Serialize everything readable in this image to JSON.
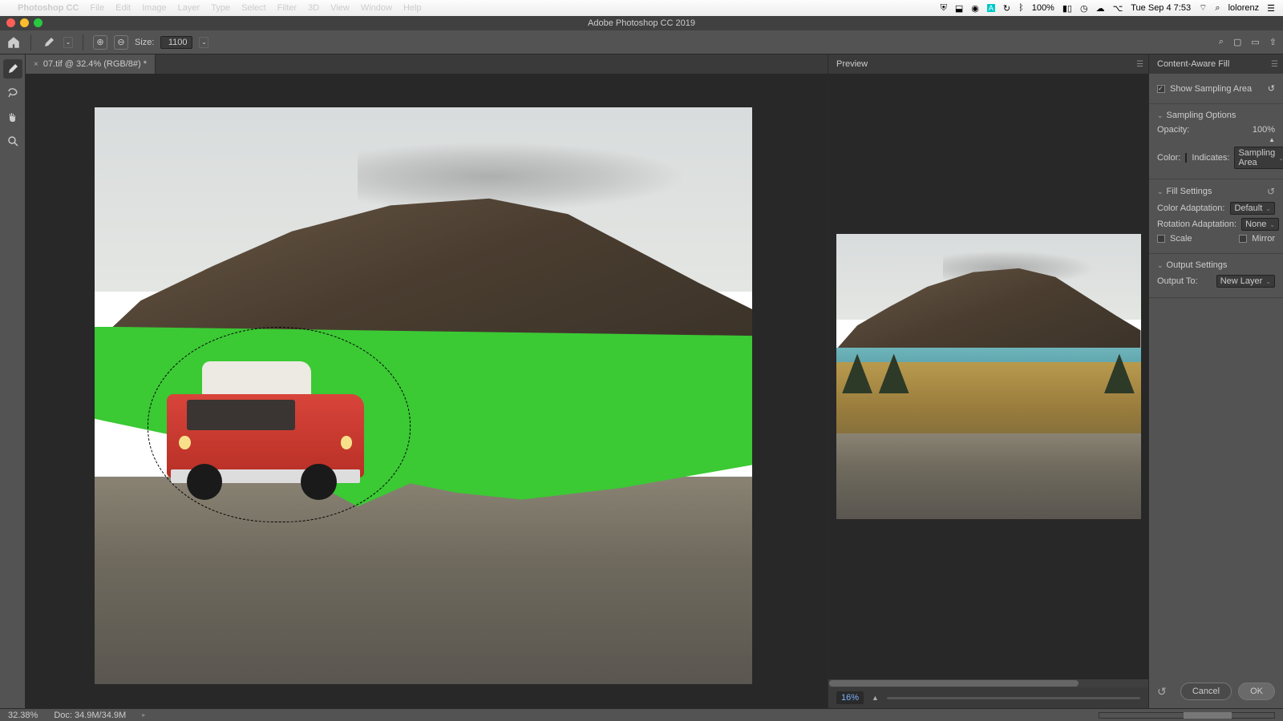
{
  "mac_menu": {
    "app": "Photoshop CC",
    "items": [
      "File",
      "Edit",
      "Image",
      "Layer",
      "Type",
      "Select",
      "Filter",
      "3D",
      "View",
      "Window",
      "Help"
    ],
    "battery": "100%",
    "clock": "Tue Sep 4  7:53",
    "user": "lolorenz"
  },
  "window_title": "Adobe Photoshop CC 2019",
  "options_bar": {
    "size_label": "Size:",
    "size_value": "1100"
  },
  "doc_tab": {
    "label": "07.tif @ 32.4% (RGB/8#) *"
  },
  "preview_panel": {
    "title": "Preview",
    "zoom": "16%"
  },
  "caf_panel": {
    "title": "Content-Aware Fill",
    "show_sampling": "Show Sampling Area",
    "sampling_options": "Sampling Options",
    "opacity_label": "Opacity:",
    "opacity_value": "100%",
    "color_label": "Color:",
    "indicates_label": "Indicates:",
    "indicates_value": "Sampling Area",
    "fill_settings": "Fill Settings",
    "color_adapt_label": "Color Adaptation:",
    "color_adapt_value": "Default",
    "rotation_label": "Rotation Adaptation:",
    "rotation_value": "None",
    "scale": "Scale",
    "mirror": "Mirror",
    "output_settings": "Output Settings",
    "output_to_label": "Output To:",
    "output_to_value": "New Layer",
    "cancel": "Cancel",
    "ok": "OK"
  },
  "status": {
    "zoom": "32.38%",
    "doc": "Doc: 34.9M/34.9M"
  }
}
